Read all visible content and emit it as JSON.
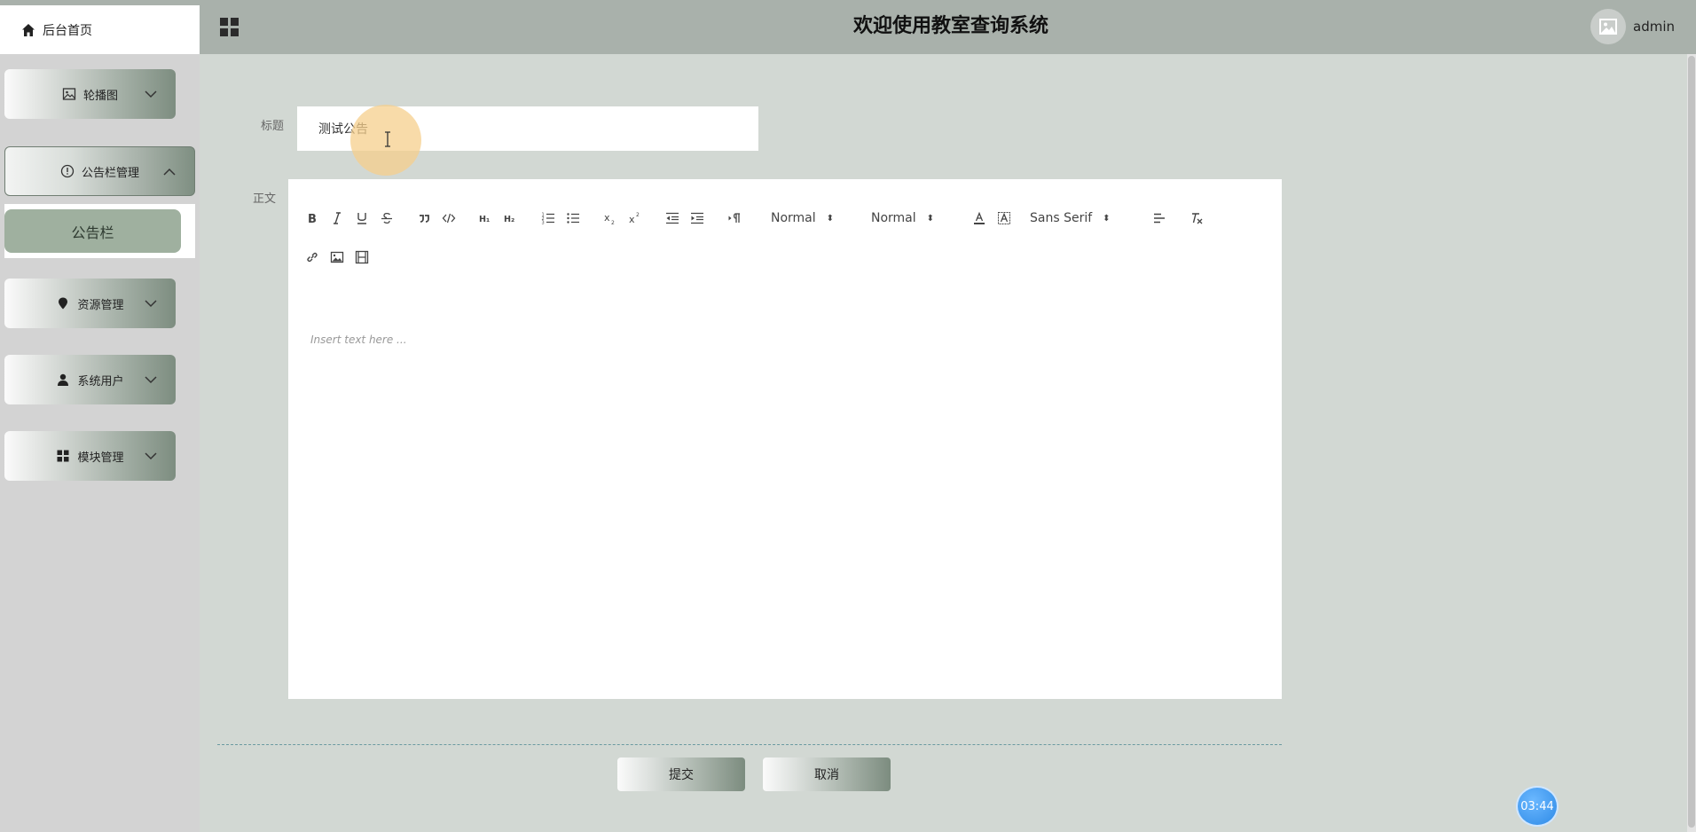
{
  "header": {
    "home_tab": "后台首页",
    "title": "欢迎使用教室查询系统",
    "username": "admin"
  },
  "sidebar": {
    "items": [
      {
        "label": "轮播图"
      },
      {
        "label": "公告栏管理",
        "expanded": true,
        "children": [
          {
            "label": "公告栏"
          }
        ]
      },
      {
        "label": "资源管理"
      },
      {
        "label": "系统用户"
      },
      {
        "label": "模块管理"
      }
    ]
  },
  "form": {
    "title_label": "标题",
    "title_value": "测试公告",
    "body_label": "正文",
    "editor": {
      "header_picker": "Normal",
      "size_picker": "Normal",
      "font_picker": "Sans Serif",
      "placeholder": "Insert text here ..."
    },
    "submit_label": "提交",
    "cancel_label": "取消"
  },
  "timer": "03:44",
  "colors": {
    "header_bg": "#a9b1ab",
    "page_bg": "#d2d8d3",
    "sidebar_bg": "#d3d3d3",
    "submenu_active": "#9fb09f",
    "timer_blue": "#2e8ae6"
  }
}
